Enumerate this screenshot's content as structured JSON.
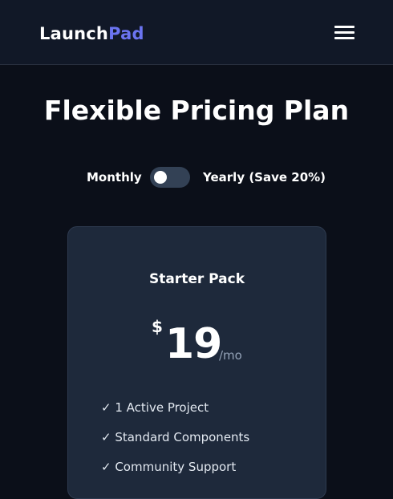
{
  "brand": {
    "name_part1": "Launch",
    "name_part2": "Pad",
    "accent_color": "#6b74f0"
  },
  "nav": {
    "menu_icon": "hamburger-menu-icon"
  },
  "page": {
    "title": "Flexible Pricing Plan"
  },
  "billing_toggle": {
    "monthly_label": "Monthly",
    "yearly_label": "Yearly (Save 20%)",
    "selected": "Monthly"
  },
  "plan": {
    "name": "Starter Pack",
    "currency": "$",
    "price": "19",
    "period": "/mo",
    "features": [
      "✓ 1 Active Project",
      "✓ Standard Components",
      "✓ Community Support"
    ]
  },
  "colors": {
    "background": "#0b0f19",
    "navbar": "#111827",
    "card": "#1e293b",
    "toggle_track": "#334155",
    "muted_text": "#94a3b8"
  }
}
